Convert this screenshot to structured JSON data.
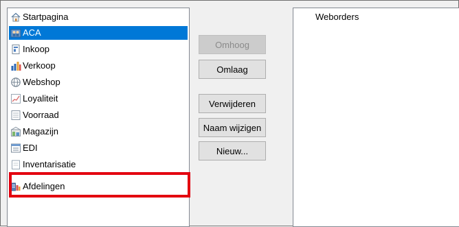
{
  "left_list": {
    "items": [
      {
        "label": "Startpagina",
        "icon": "home-icon",
        "selected": false
      },
      {
        "label": "ACA",
        "icon": "people-icon",
        "selected": true
      },
      {
        "label": "Inkoop",
        "icon": "document-icon",
        "selected": false
      },
      {
        "label": "Verkoop",
        "icon": "bar-chart-icon",
        "selected": false
      },
      {
        "label": "Webshop",
        "icon": "globe-icon",
        "selected": false
      },
      {
        "label": "Loyaliteit",
        "icon": "line-chart-icon",
        "selected": false
      },
      {
        "label": "Voorraad",
        "icon": "inventory-icon",
        "selected": false
      },
      {
        "label": "Magazijn",
        "icon": "warehouse-icon",
        "selected": false
      },
      {
        "label": "EDI",
        "icon": "edi-icon",
        "selected": false
      },
      {
        "label": "Inventarisatie",
        "icon": "clipboard-icon",
        "selected": false
      },
      {
        "label": "Afdelingen",
        "icon": "departments-icon",
        "selected": false
      }
    ]
  },
  "buttons": {
    "up": {
      "label": "Omhoog",
      "enabled": false
    },
    "down": {
      "label": "Omlaag",
      "enabled": true
    },
    "delete": {
      "label": "Verwijderen",
      "enabled": true
    },
    "rename": {
      "label": "Naam wijzigen",
      "enabled": true
    },
    "new": {
      "label": "Nieuw...",
      "enabled": true
    }
  },
  "right_list": {
    "items": [
      {
        "label": "Weborders"
      }
    ]
  },
  "colors": {
    "selection": "#0078d7",
    "highlight": "#e3000f"
  }
}
